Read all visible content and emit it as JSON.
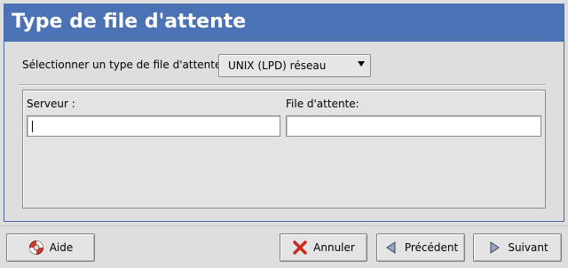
{
  "header": {
    "title": "Type de file d'attente"
  },
  "queue_type": {
    "label": "Sélectionner un type de file d'attente:",
    "selected": "UNIX (LPD) réseau"
  },
  "server_field": {
    "label": "Serveur :",
    "value": ""
  },
  "queue_field": {
    "label": "File d'attente:",
    "value": ""
  },
  "buttons": {
    "help": "Aide",
    "cancel": "Annuler",
    "previous": "Précédent",
    "next": "Suivant"
  },
  "icons": {
    "help": "lifebuoy-icon",
    "cancel": "red-x-icon",
    "previous": "arrow-left-icon",
    "next": "arrow-right-icon"
  },
  "colors": {
    "title_bar": "#4a72b5",
    "window_bg": "#dedede"
  }
}
